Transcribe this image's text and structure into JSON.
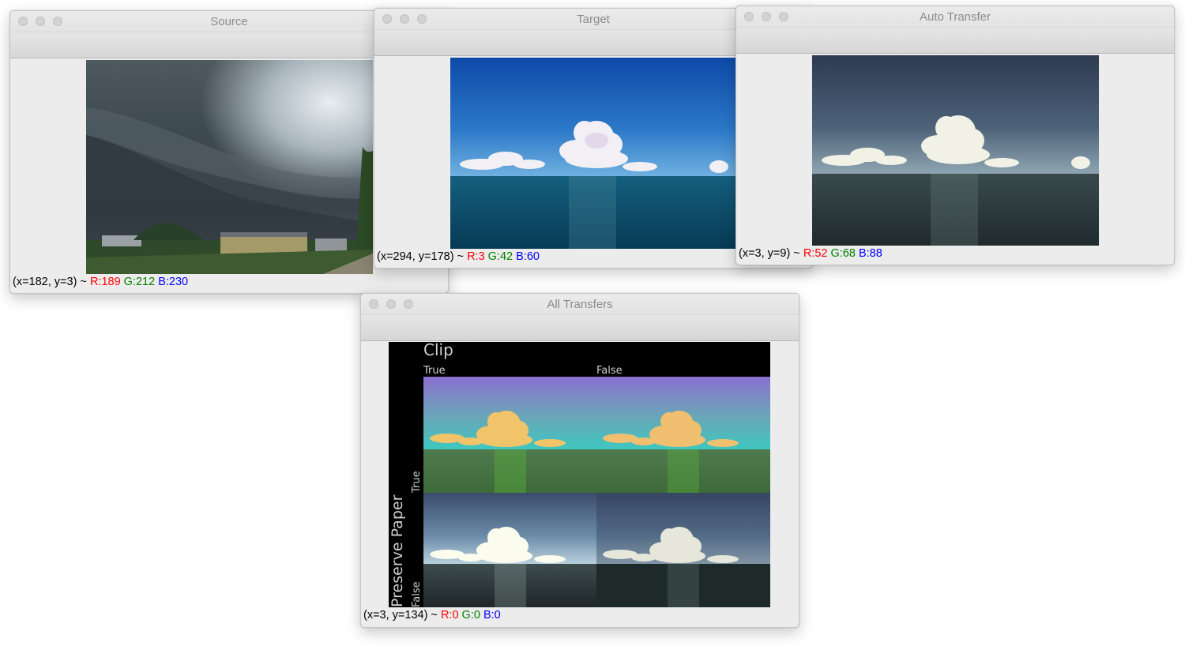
{
  "windows": {
    "source": {
      "title": "Source",
      "status": {
        "coords": "(x=182, y=3) ~ ",
        "r": "R:189",
        "g": "G:212",
        "b": "B:230"
      }
    },
    "target": {
      "title": "Target",
      "status": {
        "coords": "(x=294, y=178) ~ ",
        "r": "R:3",
        "g": "G:42",
        "b": "B:60"
      }
    },
    "auto": {
      "title": "Auto Transfer",
      "status": {
        "coords": "(x=3, y=9) ~ ",
        "r": "R:52",
        "g": "G:68",
        "b": "B:88"
      }
    },
    "all": {
      "title": "All Transfers",
      "status": {
        "coords": "(x=3, y=134) ~ ",
        "r": "R:0",
        "g": "G:0",
        "b": "B:0"
      },
      "grid": {
        "clip_label": "Clip",
        "clip_true": "True",
        "clip_false": "False",
        "preserve_label": "Preserve Paper",
        "preserve_true": "True",
        "preserve_false": "False"
      }
    }
  },
  "colors": {
    "status_r": "#ff0000",
    "status_g": "#008000",
    "status_b": "#0000ff",
    "window_bg": "#ececec"
  }
}
